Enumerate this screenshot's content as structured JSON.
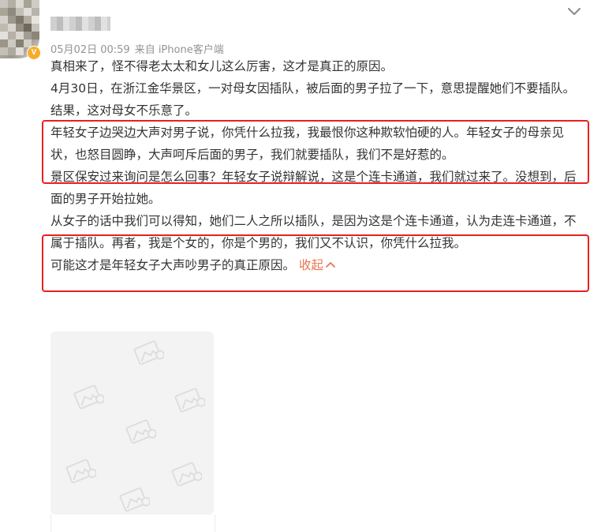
{
  "post": {
    "timestamp": "05月02日 00:59",
    "source": "来自 iPhone客户端",
    "verified_badge": "V",
    "paragraphs": [
      "真相来了，怪不得老太太和女儿这么厉害，这才是真正的原因。",
      "4月30日，在浙江金华景区，一对母女因插队，被后面的男子拉了一下，意思提醒她们不要插队。结果，这对母女不乐意了。",
      "年轻女子边哭边大声对男子说，你凭什么拉我，我最恨你这种欺软怕硬的人。年轻女子的母亲见状，也怒目圆睁，大声呵斥后面的男子，我们就要插队，我们不是好惹的。",
      "景区保安过来询问是怎么回事？年轻女子说辩解说，这是个连卡通道，我们就过来了。没想到，后面的男子开始拉她。",
      "从女子的话中我们可以得知，她们二人之所以插队，是因为这是个连卡通道，认为走连卡通道，不属于插队。再者，我是个女的，你是个男的，我们又不认识，你凭什么拉我。"
    ],
    "last_line": "可能这才是年轻女子大声吵男子的真正原因。",
    "collapse_label": "收起",
    "collapse_icon": "chevron-up-icon",
    "menu_icon": "chevron-down-icon",
    "media_placeholder_icon": "image-placeholder-icon"
  },
  "colors": {
    "text": "#333333",
    "meta": "#939393",
    "link": "#eb7350",
    "highlight_box": "#e82020",
    "placeholder_bg": "#f3f3f3",
    "badge": "#f7ad2c"
  }
}
